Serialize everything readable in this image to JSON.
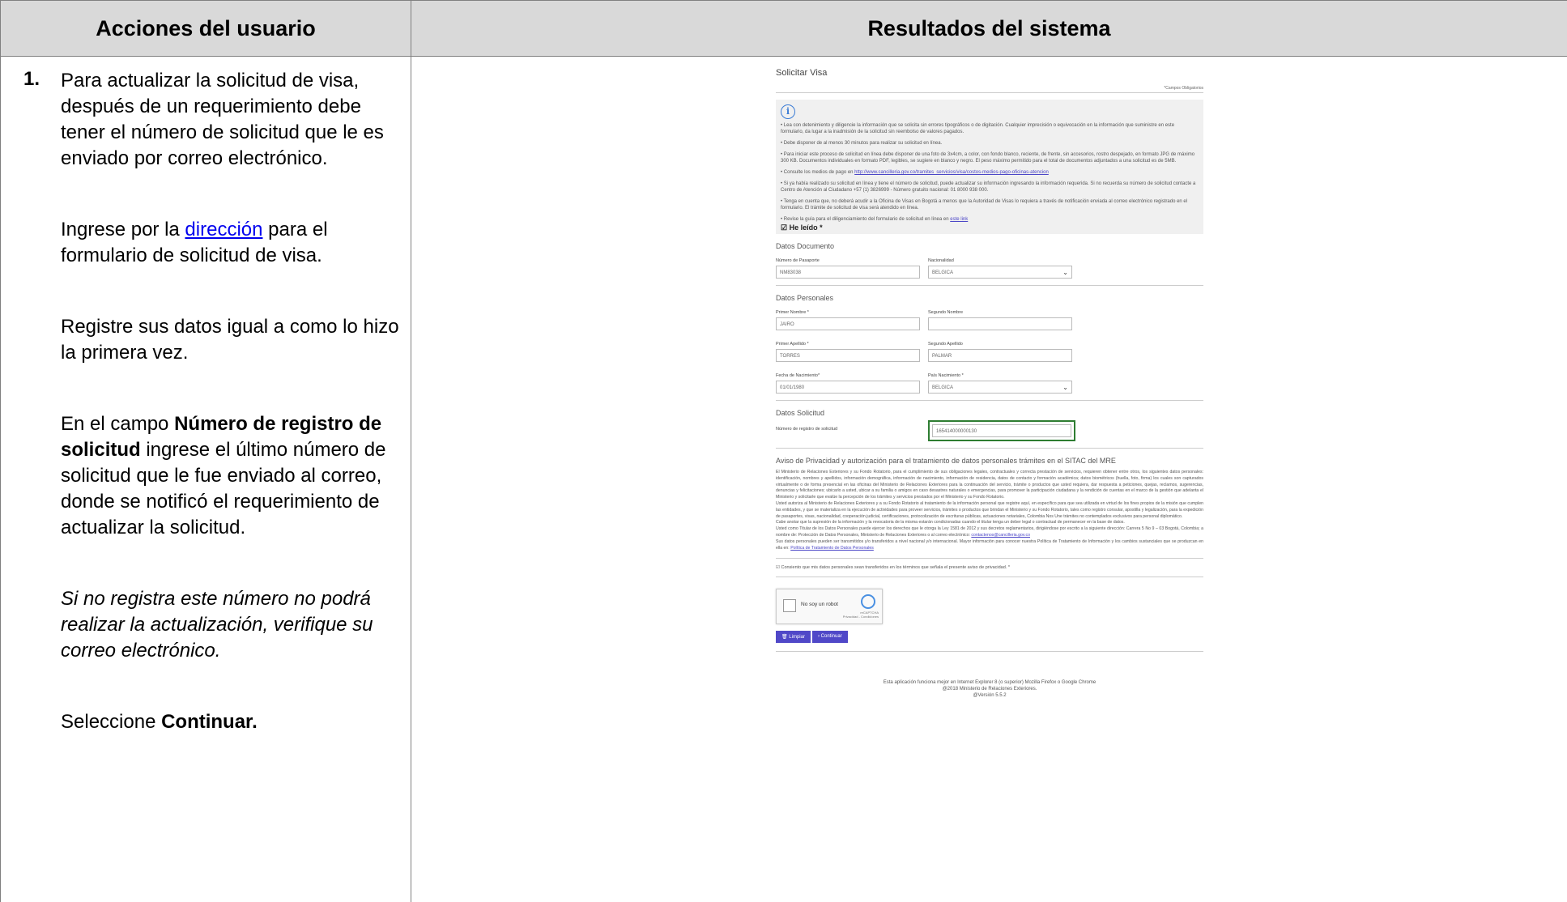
{
  "headers": {
    "left": "Acciones del usuario",
    "right": "Resultados del sistema"
  },
  "step": {
    "number": "1.",
    "p1": "Para actualizar la solicitud de visa, después de un requerimiento debe tener el número de solicitud que le es enviado por correo electrónico.",
    "p2_pre": "Ingrese por la ",
    "p2_link": "dirección",
    "p2_post": " para el formulario de solicitud de visa.",
    "p3": "Registre sus datos igual a como lo hizo la primera vez.",
    "p4_pre": "En el campo ",
    "p4_bold": "Número de registro de solicitud",
    "p4_post": " ingrese el último número de solicitud que le fue enviado al correo, donde se notificó el requerimiento de actualizar la solicitud.",
    "p5": "Si no registra este número no podrá realizar la actualización, verifique su correo electrónico.",
    "p6_pre": "Seleccione ",
    "p6_bold": "Continuar."
  },
  "form": {
    "title": "Solicitar Visa",
    "required_note": "*Campos Obligatorios",
    "info": {
      "i1": "• Lea con detenimiento y diligencie la información que se solicita sin errores tipográficos o de digitación. Cualquier imprecisión o equivocación en la información que suministre en este formulario, da lugar a la inadmisión de la solicitud sin reembolso de valores pagados.",
      "i2": "• Debe disponer de al menos 30 minutos para realizar su solicitud en línea.",
      "i3": "• Para iniciar este proceso de solicitud en línea debe disponer de una foto de 3x4cm, a color, con fondo blanco, reciente, de frente, sin accesorios, rostro despejado, en formato JPG de máximo 300 KB. Documentos individuales en formato PDF, legibles, se sugiere en blanco y negro. El peso máximo permitido para el total de documentos adjuntados a una solicitud es de 5MB.",
      "i4_pre": "• Consulte los medios de pago en ",
      "i4_link": "http://www.cancilleria.gov.co/tramites_servicios/visa/costos-medios-pago-oficinas-atencion",
      "i5": "• Si ya había realizado su solicitud en línea y tiene el número de solicitud, puede actualizar su información ingresando la información requerida. Si no recuerda su número de solicitud contacte a Centro de Atención al Ciudadano +57 (1) 3826999 - Número gratuito nacional: 01 8000 938 000.",
      "i6": "• Tenga en cuenta que, no deberá acudir a la Oficina de Visas en Bogotá a menos que la Autoridad de Visas lo requiera a través de notificación enviada al correo electrónico registrado en el formulario. El trámite de solicitud de visa será atendido en línea.",
      "i7_pre": "• Revise la guía para el diligenciamiento del formulario de solicitud en línea en ",
      "i7_link": "este link",
      "he_leido": "He leído *"
    },
    "doc_section": "Datos Documento",
    "passport_label": "Número de Pasaporte",
    "passport_value": "NM83038",
    "nationality_label": "Nacionalidad",
    "nationality_value": "BELGICA",
    "personal_section": "Datos Personales",
    "first_name_label": "Primer Nombre *",
    "first_name_value": "JAIRO",
    "second_name_label": "Segundo Nombre",
    "second_name_value": "",
    "first_surname_label": "Primer Apellido *",
    "first_surname_value": "TORRES",
    "second_surname_label": "Segundo Apellido",
    "second_surname_value": "PALMAR",
    "birth_label": "Fecha de Nacimiento*",
    "birth_value": "01/01/1980",
    "birth_country_label": "País Nacimiento *",
    "birth_country_value": "BELGICA",
    "request_section": "Datos Solicitud",
    "request_label": "Número de registro de solicitud",
    "request_value": "165414000000130",
    "privacy_title": "Aviso de Privacidad y autorización para el tratamiento de datos personales trámites en el SITAC del MRE",
    "privacy_text_1": "El Ministerio de Relaciones Exteriores y su Fondo Rotatorio, para el cumplimiento de sus obligaciones legales, contractuales y correcta prestación de servicios, requieren obtener entre otros, los siguientes datos personales: identificación, nombres y apellidos, información demográfica, información de nacimiento, información de residencia, datos de contacto y formación académica; datos biométricos (huella, foto, firma) los cuales son capturados virtualmente o de forma presencial en las oficinas del Ministerio de Relaciones Exteriores para la continuación del servicio, trámite o productos que usted requiera, dar respuesta a peticiones, quejas, reclamos, sugerencias, denuncias y felicitaciones; ubicarlo a usted, ubicar a su familia o amigos en caso desastres naturales o emergencias, para promover la participación ciudadana y la rendición de cuentas en el marco de la gestión que adelanta el Ministerio y solicitarle que evalúe la percepción de los trámites y servicios prestados por el Ministerio y su Fondo Rotatorio.",
    "privacy_text_2": "Usted autoriza al Ministerio de Relaciones Exteriores y a su Fondo Rotatorio al tratamiento de la información personal que registre aquí, en específico para que sea utilizada en virtud de los fines propios de la misión que cumplen las entidades, y que se materializa en la ejecución de actividades para proveer servicios, trámites o productos que brindan el Ministerio y su Fondo Rotatorio, tales como registro consular, apostilla y legalización, para la expedición de pasaportes, visas, nacionalidad, cooperación judicial, certificaciones, protocolización de escrituras públicas, actuaciones notariales, Colombia Nos Une trámites no contemplados exclusivos para personal diplomático.",
    "privacy_text_3": "Cabe anotar que la supresión de la información y la revocatoria de la misma estarán condicionadas cuando el titular tenga un deber legal o contractual de permanecer en la base de datos.",
    "privacy_text_4": "Usted como Titular de los Datos Personales puede ejercer los derechos que le otorga la Ley 1581 de 2012 y sus decretos reglamentarios, dirigiéndose por escrito a la siguiente dirección: Carrera 5 No 9 – 03 Bogotá, Colombia; a nombre de: Protección de Datos Personales, Ministerio de Relaciones Exteriores o al correo electrónico:",
    "privacy_email": "contactenos@cancilleria.gov.co",
    "privacy_text_5": "Sus datos personales pueden ser transmitidos y/o transferidos a nivel nacional y/o internacional. Mayor información para conocer nuestra Política de Tratamiento de Información y los cambios sustanciales que se produzcan en ella en:",
    "privacy_policy_link": "Política de Tratamiento de Datos Personales",
    "consent": "Consiento que mis datos personales sean transferidos en los términos que señala el presente aviso de privacidad. *",
    "captcha_text": "No soy un robot",
    "captcha_brand": "reCAPTCHA",
    "captcha_terms": "Privacidad - Condiciones",
    "btn_clear": "Limpiar",
    "btn_continue": "Continuar",
    "footer_1": "Esta aplicación funciona mejor en Internet Explorer 8 (o superior)",
    "footer_browsers": "Mozilla Firefox   o Google Chrome",
    "footer_2": "@2018 Ministerio de Relaciones Exteriores.",
    "footer_3": "@Versión 5.5.2"
  }
}
